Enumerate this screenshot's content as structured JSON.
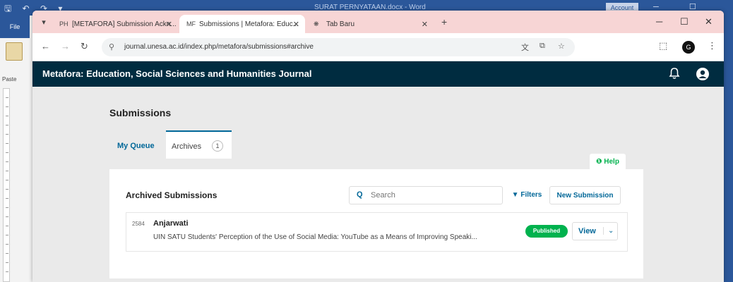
{
  "word": {
    "quick_access": "🖫 ↶ ↷ ▾",
    "doc_title": "SURAT PERNYATAAN.docx - Word",
    "account": "Account",
    "window_controls": "─ ☐ ✕",
    "file_tab": "File",
    "paste_label": "Paste"
  },
  "browser": {
    "tabs": [
      {
        "favicon": "PH",
        "label": "[METAFORA] Submission Ackn...",
        "state": "inactive"
      },
      {
        "favicon": "MF",
        "label": "Submissions | Metafora: Educ...",
        "state": "active"
      },
      {
        "favicon": "❋",
        "label": "Tab Baru",
        "state": "inactive"
      }
    ],
    "tab_close": "✕",
    "new_tab": "+",
    "window_controls": {
      "minimize": "─",
      "maximize": "☐",
      "close": "✕"
    },
    "nav": {
      "back": "←",
      "forward": "→",
      "reload": "↻"
    },
    "site_info": "⚲",
    "url": "journal.unesa.ac.id/index.php/metafora/submissions#archive",
    "omnibox_icons": {
      "translate": "文",
      "extension": "⧉",
      "bookmark": "☆"
    },
    "toolbar": {
      "puzzle": "⬚",
      "menu": "⋮"
    },
    "profile_initial": "G"
  },
  "app": {
    "title": "Metafora: Education, Social Sciences and Humanities Journal"
  },
  "page": {
    "title": "Submissions",
    "tabs": {
      "my_queue": "My Queue",
      "archives": "Archives",
      "archives_count": "1"
    },
    "help_label": "❶ Help",
    "list": {
      "title": "Archived Submissions",
      "search_icon": "Q",
      "search_placeholder": "Search",
      "filters_label": "▼ Filters",
      "new_submission_label": "New Submission"
    },
    "row": {
      "id": "2584",
      "author": "Anjarwati",
      "title": "UIN SATU Students' Perception of the Use of Social Media: YouTube as a Means of Improving Speaki...",
      "status": "Published",
      "view_label": "View",
      "caret": "⌄"
    }
  },
  "colors": {
    "app_header": "#002c40",
    "link": "#006798",
    "status_published": "#00b24e",
    "tab_strip": "#f7d5d5",
    "word_blue": "#2b579a"
  }
}
